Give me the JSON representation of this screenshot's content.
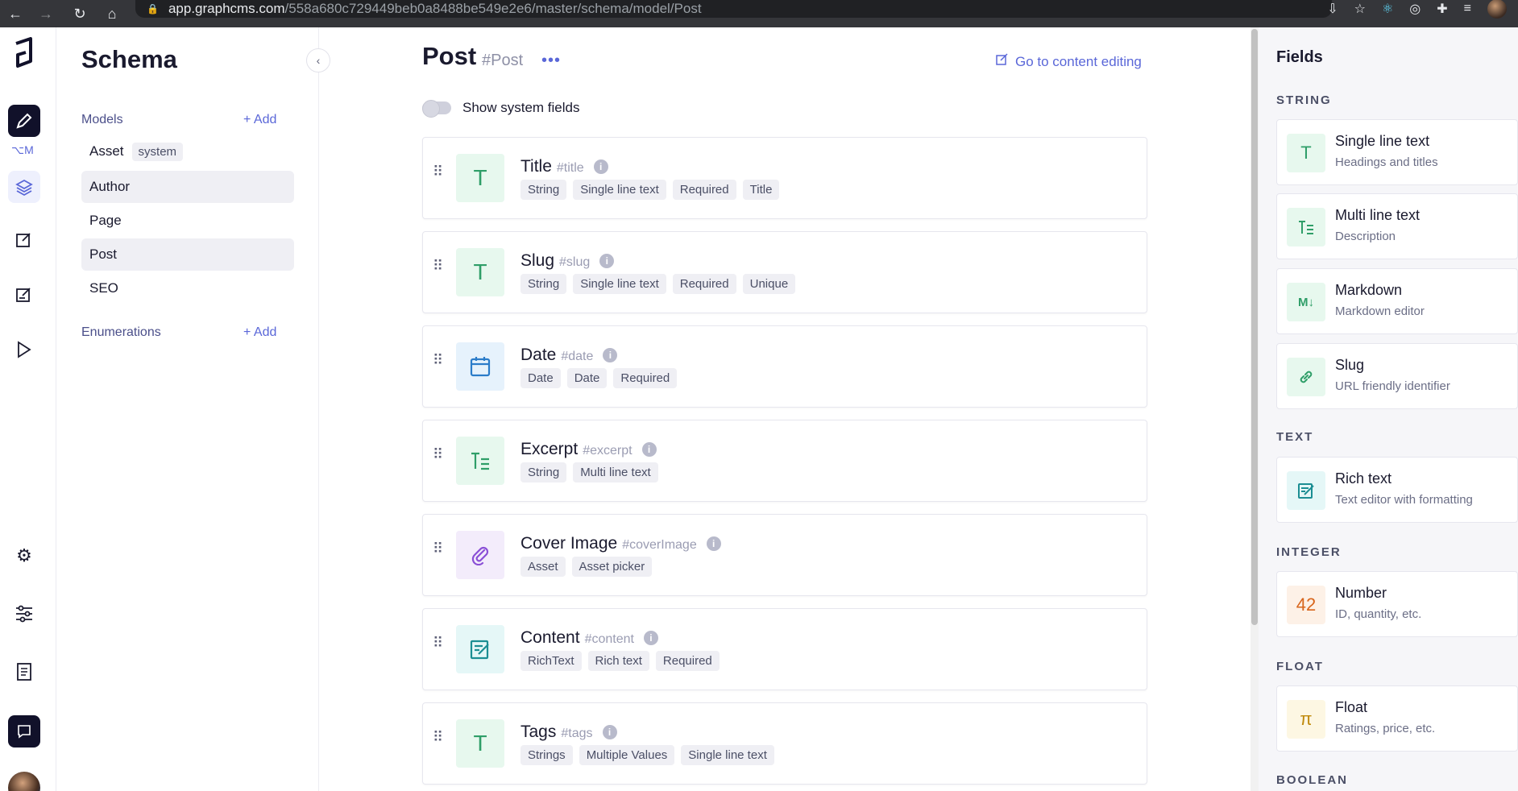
{
  "browser": {
    "url_host": "app.graphcms.com",
    "url_path": "/558a680c729449beb0a8488be549e2e6/master/schema/model/Post"
  },
  "rail": {
    "schema_badge": "⌥M"
  },
  "sidebar": {
    "title": "Schema",
    "models_label": "Models",
    "models_add": "+ Add",
    "models": [
      {
        "name": "Asset",
        "badge": "system"
      },
      {
        "name": "Author"
      },
      {
        "name": "Page"
      },
      {
        "name": "Post"
      },
      {
        "name": "SEO"
      }
    ],
    "enumerations_label": "Enumerations",
    "enumerations_add": "+ Add"
  },
  "main": {
    "title": "Post",
    "api_id": "#Post",
    "more": "•••",
    "content_link": "Go to content editing",
    "toggle_label": "Show system fields",
    "fields": [
      {
        "name": "Title",
        "api": "#title",
        "icon": "T",
        "tags": [
          "String",
          "Single line text",
          "Required",
          "Title"
        ]
      },
      {
        "name": "Slug",
        "api": "#slug",
        "icon": "T",
        "tags": [
          "String",
          "Single line text",
          "Required",
          "Unique"
        ]
      },
      {
        "name": "Date",
        "api": "#date",
        "icon": "calendar-icon",
        "tags": [
          "Date",
          "Date",
          "Required"
        ]
      },
      {
        "name": "Excerpt",
        "api": "#excerpt",
        "icon": "multiline-icon",
        "tags": [
          "String",
          "Multi line text"
        ]
      },
      {
        "name": "Cover Image",
        "api": "#coverImage",
        "icon": "paperclip-icon",
        "tags": [
          "Asset",
          "Asset picker"
        ]
      },
      {
        "name": "Content",
        "api": "#content",
        "icon": "richtext-icon",
        "tags": [
          "RichText",
          "Rich text",
          "Required"
        ]
      },
      {
        "name": "Tags",
        "api": "#tags",
        "icon": "T",
        "tags": [
          "Strings",
          "Multiple Values",
          "Single line text"
        ]
      }
    ]
  },
  "fields_panel": {
    "title": "Fields",
    "categories": {
      "string": "STRING",
      "text": "TEXT",
      "integer": "INTEGER",
      "float": "FLOAT",
      "boolean": "BOOLEAN"
    },
    "items": [
      {
        "name": "Single line text",
        "desc": "Headings and titles",
        "glyph": "T"
      },
      {
        "name": "Multi line text",
        "desc": "Description",
        "glyph": "T="
      },
      {
        "name": "Markdown",
        "desc": "Markdown editor",
        "glyph": "M↓"
      },
      {
        "name": "Slug",
        "desc": "URL friendly identifier",
        "glyph": "link-icon"
      },
      {
        "name": "Rich text",
        "desc": "Text editor with formatting",
        "glyph": "richtext-icon"
      },
      {
        "name": "Number",
        "desc": "ID, quantity, etc.",
        "glyph": "42"
      },
      {
        "name": "Float",
        "desc": "Ratings, price, etc.",
        "glyph": "π"
      }
    ]
  }
}
